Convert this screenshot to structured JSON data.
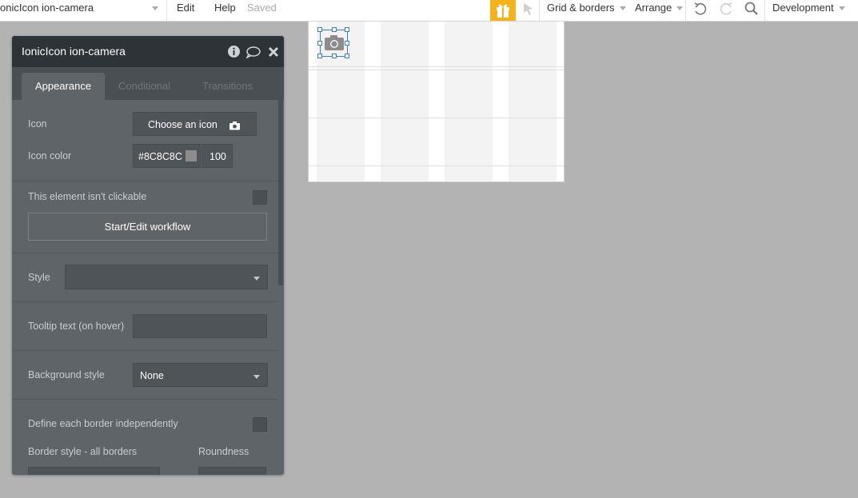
{
  "toolbar": {
    "page_name": "onicIcon ion-camera",
    "edit_label": "Edit",
    "help_label": "Help",
    "saved_label": "Saved",
    "grid_borders_label": "Grid & borders",
    "arrange_label": "Arrange",
    "environment_label": "Development",
    "gift_color": "#f6b21a"
  },
  "panel": {
    "title": "IonicIcon ion-camera",
    "tabs": [
      {
        "label": "Appearance",
        "active": true
      },
      {
        "label": "Conditional",
        "active": false
      },
      {
        "label": "Transitions",
        "active": false
      }
    ],
    "icon_label": "Icon",
    "choose_icon_label": "Choose an icon",
    "icon_color_label": "Icon color",
    "icon_color_value": "#8C8C8C",
    "icon_opacity_value": "100",
    "not_clickable_label": "This element isn't clickable",
    "workflow_button_label": "Start/Edit workflow",
    "style_label": "Style",
    "style_value": "",
    "tooltip_label": "Tooltip text (on hover)",
    "tooltip_value": "",
    "background_style_label": "Background style",
    "background_style_value": "None",
    "define_border_label": "Define each border independently",
    "border_style_label": "Border style - all borders",
    "roundness_label": "Roundness"
  },
  "icons": [
    "gift-icon",
    "pointer-icon",
    "undo-icon",
    "redo-icon",
    "search-icon",
    "info-icon",
    "comment-icon",
    "close-icon",
    "camera-icon"
  ]
}
